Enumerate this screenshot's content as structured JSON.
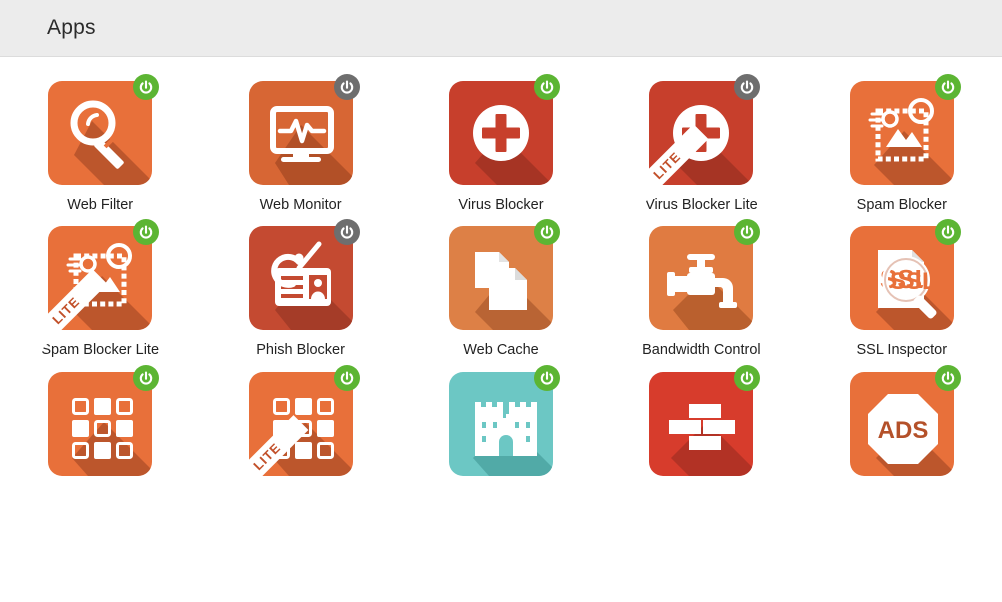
{
  "header": {
    "title": "Apps"
  },
  "colors": {
    "header_bg": "#ececec",
    "page_bg": "#ffffff",
    "badge_on": "#5cb533",
    "badge_off": "#6e6e6e",
    "label": "#232323",
    "lite_text": "#c2502a"
  },
  "apps": [
    {
      "label": "Web Filter",
      "icon": "magnifier-icon",
      "power": "on",
      "lite": false,
      "tile_color": "#e8703a",
      "shadow_color": "#b4512a"
    },
    {
      "label": "Web Monitor",
      "icon": "monitor-pulse-icon",
      "power": "off",
      "lite": false,
      "tile_color": "#d76634",
      "shadow_color": "#ab4c26"
    },
    {
      "label": "Virus Blocker",
      "icon": "medical-cross-icon",
      "power": "on",
      "lite": false,
      "tile_color": "#c73f2c",
      "shadow_color": "#a23324"
    },
    {
      "label": "Virus Blocker Lite",
      "icon": "medical-cross-icon",
      "power": "off",
      "lite": true,
      "tile_color": "#c73f2c",
      "shadow_color": "#a23324"
    },
    {
      "label": "Spam Blocker",
      "icon": "postage-stamp-icon",
      "power": "on",
      "lite": false,
      "tile_color": "#e8703a",
      "shadow_color": "#b4512a"
    },
    {
      "label": "Spam Blocker Lite",
      "icon": "postage-stamp-icon",
      "power": "on",
      "lite": true,
      "tile_color": "#e8703a",
      "shadow_color": "#b4512a"
    },
    {
      "label": "Phish Blocker",
      "icon": "id-card-hook-icon",
      "power": "off",
      "lite": false,
      "tile_color": "#c44a31",
      "shadow_color": "#a03a27"
    },
    {
      "label": "Web Cache",
      "icon": "documents-icon",
      "power": "on",
      "lite": false,
      "tile_color": "#dd8046",
      "shadow_color": "#b35f31"
    },
    {
      "label": "Bandwidth Control",
      "icon": "faucet-valve-icon",
      "power": "on",
      "lite": false,
      "tile_color": "#e07b41",
      "shadow_color": "#b35c2c"
    },
    {
      "label": "SSL Inspector",
      "icon": "ssl-document-magnifier-icon",
      "power": "on",
      "lite": false,
      "tile_color": "#e8703a",
      "shadow_color": "#b4512a"
    },
    {
      "label": "",
      "icon": "app-grid-icon",
      "power": "on",
      "lite": false,
      "tile_color": "#e8703a",
      "shadow_color": "#b4512a"
    },
    {
      "label": "",
      "icon": "app-grid-icon",
      "power": "on",
      "lite": true,
      "tile_color": "#e8703a",
      "shadow_color": "#b4512a"
    },
    {
      "label": "",
      "icon": "castle-icon",
      "power": "on",
      "lite": false,
      "tile_color": "#6cc7c4",
      "shadow_color": "#4ba3a0"
    },
    {
      "label": "",
      "icon": "brick-wall-icon",
      "power": "on",
      "lite": false,
      "tile_color": "#d73c2c",
      "shadow_color": "#ab3024"
    },
    {
      "label": "",
      "icon": "ads-octagon-icon",
      "power": "on",
      "lite": false,
      "tile_color": "#e8703a",
      "shadow_color": "#b4512a"
    }
  ],
  "lite_badge_text": "LITE",
  "ads_text": "ADS",
  "ssl_text": "SSL"
}
